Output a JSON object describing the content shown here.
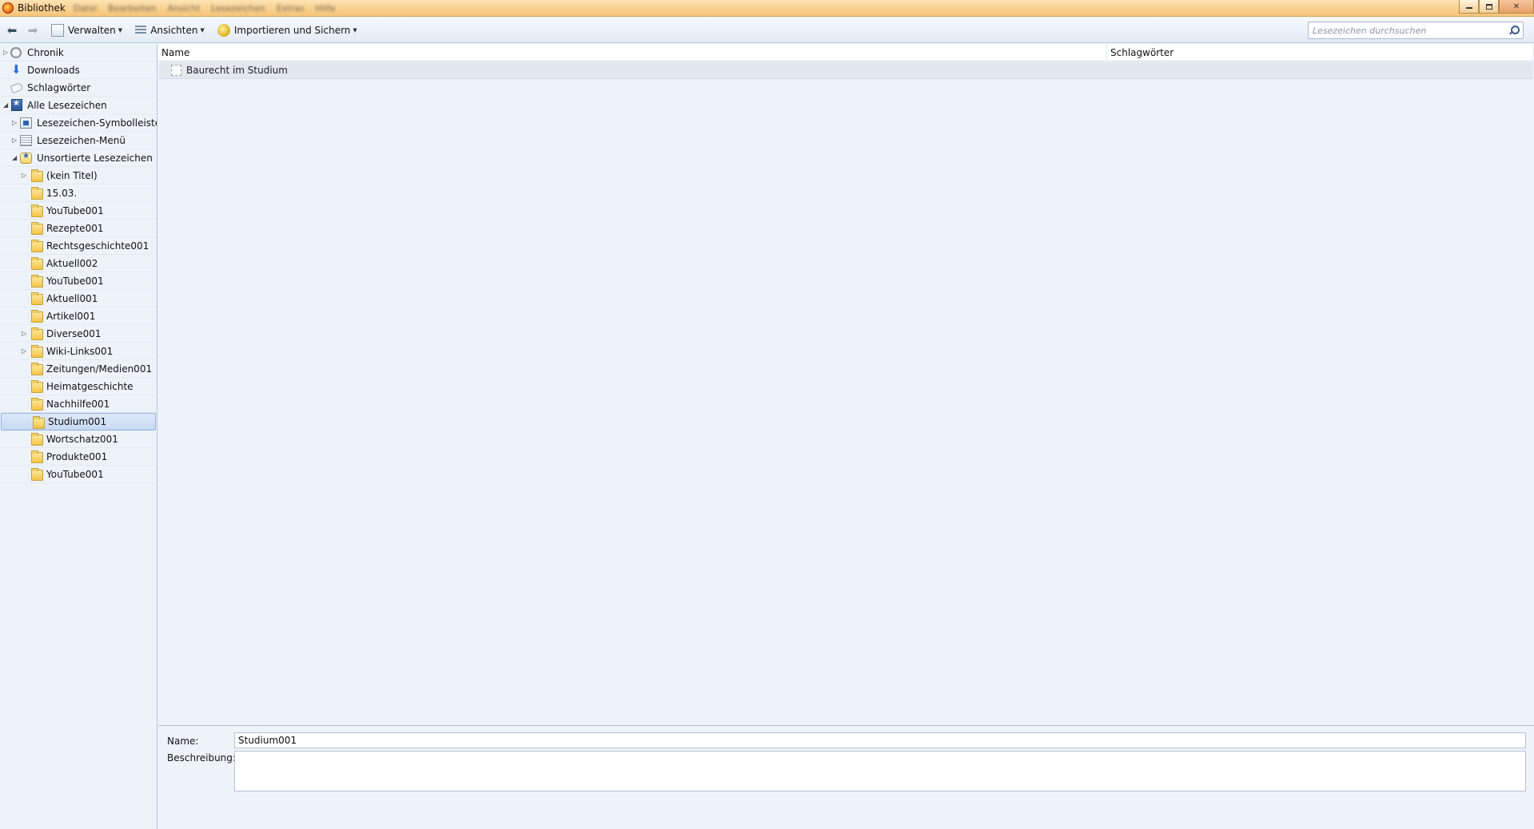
{
  "window": {
    "title": "Bibliothek",
    "menu": [
      "Datei",
      "Bearbeiten",
      "Ansicht",
      "Lesezeichen",
      "Extras",
      "Hilfe"
    ]
  },
  "toolbar": {
    "organize": "Verwalten",
    "views": "Ansichten",
    "import_backup": "Importieren und Sichern",
    "search_placeholder": "Lesezeichen durchsuchen"
  },
  "tree": {
    "history": "Chronik",
    "downloads": "Downloads",
    "tags": "Schlagwörter",
    "all_bookmarks": "Alle Lesezeichen",
    "bookmarks_toolbar": "Lesezeichen-Symbolleiste",
    "bookmarks_menu": "Lesezeichen-Menü",
    "unsorted": "Unsortierte Lesezeichen",
    "folders": [
      {
        "label": "(kein Titel)",
        "expandable": true
      },
      {
        "label": "15.03.",
        "expandable": false
      },
      {
        "label": "YouTube001",
        "expandable": false
      },
      {
        "label": "Rezepte001",
        "expandable": false
      },
      {
        "label": "Rechtsgeschichte001",
        "expandable": false
      },
      {
        "label": "Aktuell002",
        "expandable": false
      },
      {
        "label": "YouTube001",
        "expandable": false
      },
      {
        "label": "Aktuell001",
        "expandable": false
      },
      {
        "label": "Artikel001",
        "expandable": false
      },
      {
        "label": "Diverse001",
        "expandable": true
      },
      {
        "label": "Wiki-Links001",
        "expandable": true
      },
      {
        "label": "Zeitungen/Medien001",
        "expandable": false
      },
      {
        "label": "Heimatgeschichte",
        "expandable": false
      },
      {
        "label": "Nachhilfe001",
        "expandable": false
      },
      {
        "label": "Studium001",
        "expandable": false,
        "selected": true
      },
      {
        "label": "Wortschatz001",
        "expandable": false
      },
      {
        "label": "Produkte001",
        "expandable": false
      },
      {
        "label": "YouTube001",
        "expandable": false
      }
    ]
  },
  "list": {
    "columns": {
      "name": "Name",
      "tags": "Schlagwörter"
    },
    "rows": [
      {
        "name": "Baurecht im Studium",
        "tags": ""
      }
    ]
  },
  "details": {
    "name_label": "Name:",
    "name_value": "Studium001",
    "description_label": "Beschreibung:",
    "description_value": ""
  }
}
